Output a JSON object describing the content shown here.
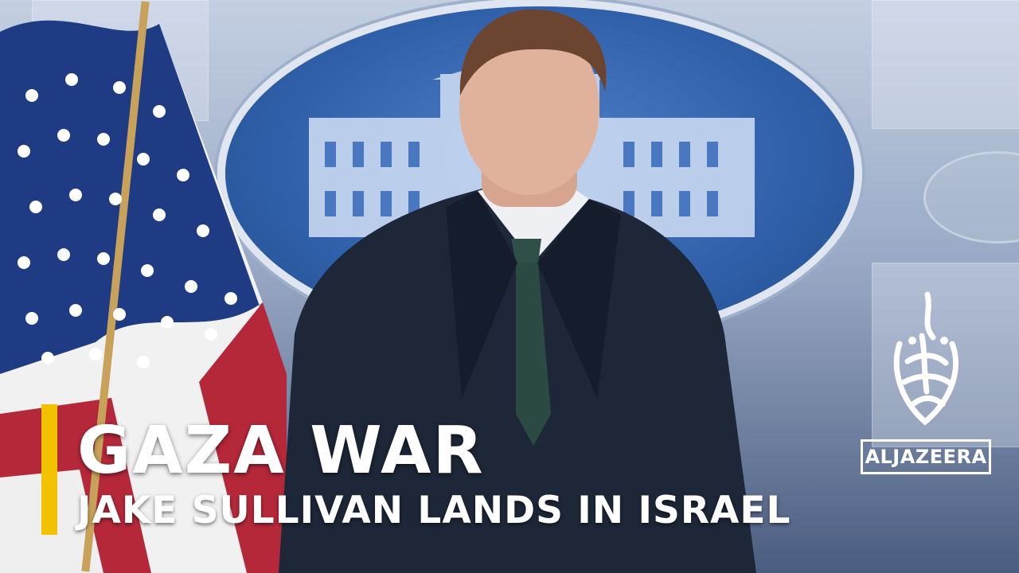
{
  "headline": "GAZA WAR",
  "subheadline": "JAKE SULLIVAN LANDS IN ISRAEL",
  "logo": {
    "wordmark": "ALJAZEERA",
    "icon": "aljazeera-calligraphy-icon"
  },
  "colors": {
    "accent": "#f2c200",
    "text": "#ffffff",
    "seal_blue": "#2f5fa8"
  }
}
